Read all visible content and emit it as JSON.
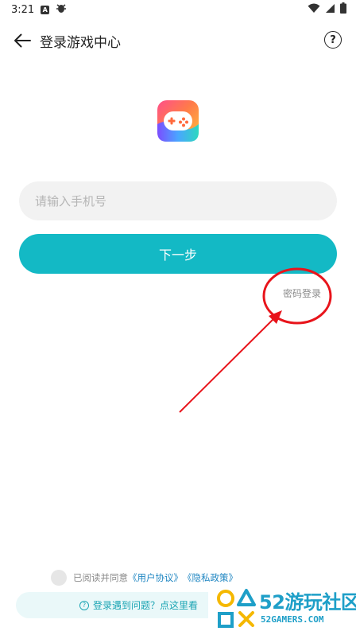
{
  "status_bar": {
    "time": "3:21",
    "notification_a": "A"
  },
  "header": {
    "title": "登录游戏中心"
  },
  "login": {
    "phone_placeholder": "请输入手机号",
    "next_label": "下一步",
    "password_login_label": "密码登录"
  },
  "agreement": {
    "prefix": "已阅读并同意",
    "user_agreement": "《用户协议》",
    "privacy_policy": "《隐私政策》"
  },
  "help_bar": {
    "text": "登录遇到问题？点这里看"
  },
  "watermark": {
    "brand_num": "52",
    "brand_cn": "游玩社区",
    "domain": "52GAMERS.COM"
  },
  "colors": {
    "accent": "#13b9c5",
    "link": "#1f86c2",
    "annotation": "#e8141b",
    "watermark": "#1e9fc8"
  }
}
